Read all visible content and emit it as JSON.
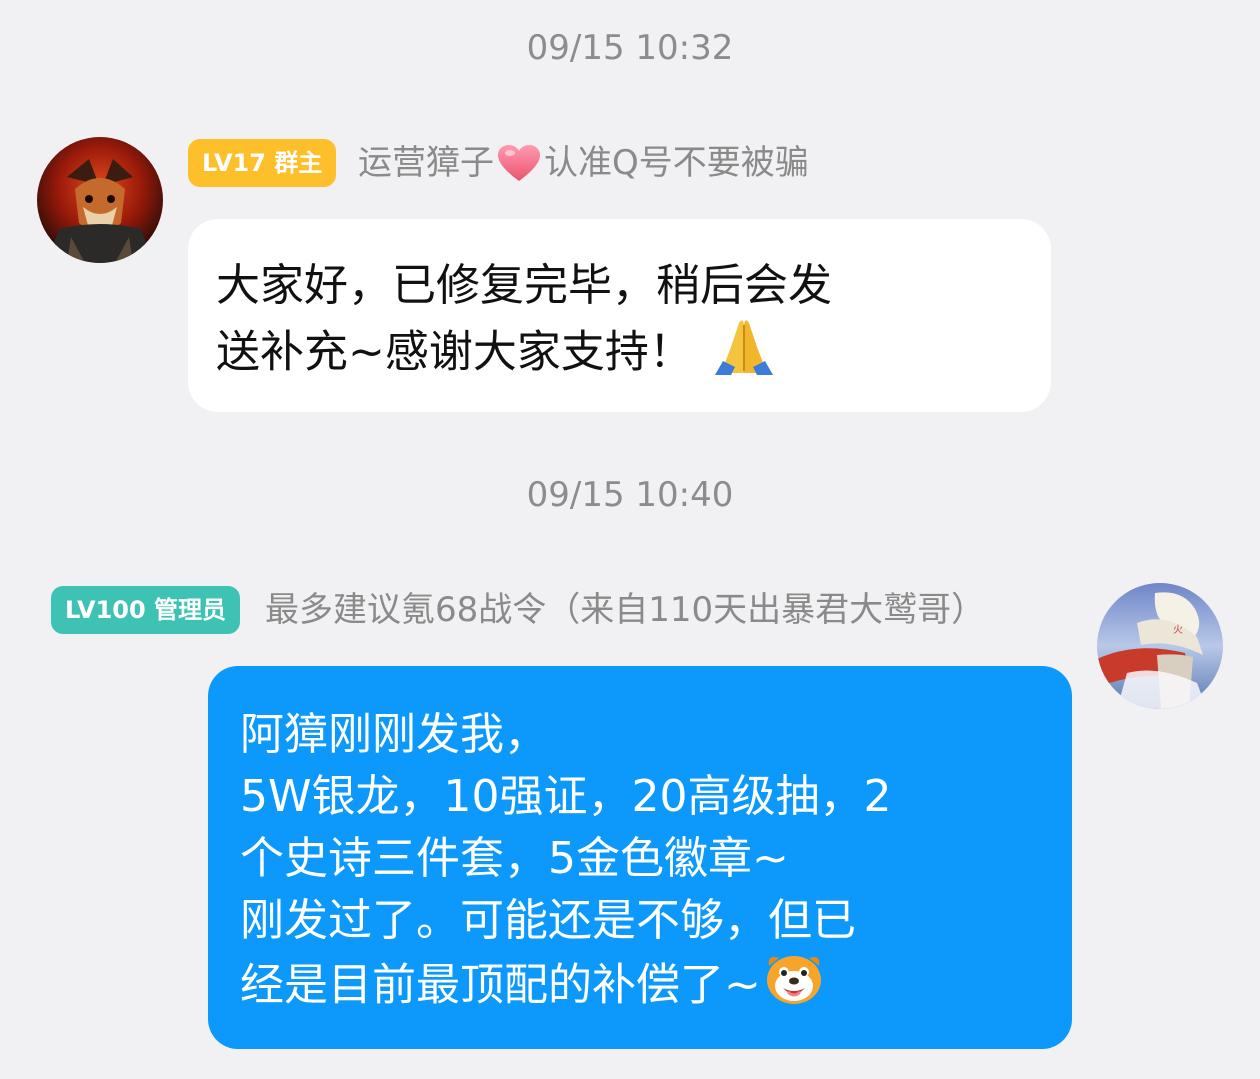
{
  "messages": [
    {
      "timestamp": "09/15 10:32",
      "badge": "LV17 群主",
      "sender": "运营獐子",
      "sender_suffix": "认准Q号不要被骗",
      "sender_heart_icon": "heart-icon",
      "lines": [
        "大家好，已修复完毕，稍后会发",
        "送补充~感谢大家支持！"
      ],
      "trailing_emoji": "folded-hands-icon"
    },
    {
      "timestamp": "09/15 10:40",
      "badge": "LV100 管理员",
      "sender": "最多建议氪68战令（来自110天出暴君大鹫哥）",
      "lines": [
        "阿獐刚刚发我，",
        "5W银龙，10强证，20高级抽，2",
        "个史诗三件套，5金色徽章~",
        "刚发过了。可能还是不够，但已",
        "经是目前最顶配的补偿了~"
      ],
      "trailing_emoji": "dog-face-icon"
    }
  ],
  "colors": {
    "background": "#f1f1f4",
    "owner_badge": "#fdc02b",
    "admin_badge": "#3ec2b4",
    "outgoing_bubble": "#0c99fb",
    "incoming_bubble": "#ffffff"
  }
}
